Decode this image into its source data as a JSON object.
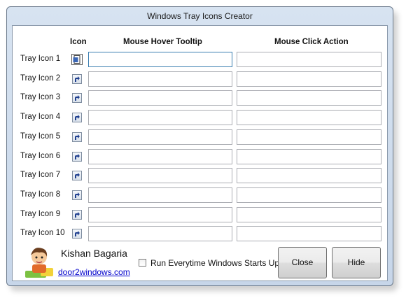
{
  "window": {
    "title": "Windows Tray Icons Creator"
  },
  "columns": {
    "icon": "Icon",
    "tooltip": "Mouse Hover Tooltip",
    "action": "Mouse Click Action"
  },
  "rows": [
    {
      "label": "Tray Icon 1",
      "tooltip": "",
      "action": ""
    },
    {
      "label": "Tray Icon 2",
      "tooltip": "",
      "action": ""
    },
    {
      "label": "Tray Icon 3",
      "tooltip": "",
      "action": ""
    },
    {
      "label": "Tray Icon 4",
      "tooltip": "",
      "action": ""
    },
    {
      "label": "Tray Icon 5",
      "tooltip": "",
      "action": ""
    },
    {
      "label": "Tray Icon 6",
      "tooltip": "",
      "action": ""
    },
    {
      "label": "Tray Icon 7",
      "tooltip": "",
      "action": ""
    },
    {
      "label": "Tray Icon 8",
      "tooltip": "",
      "action": ""
    },
    {
      "label": "Tray Icon 9",
      "tooltip": "",
      "action": ""
    },
    {
      "label": "Tray Icon 10",
      "tooltip": "",
      "action": ""
    }
  ],
  "footer": {
    "author": "Kishan Bagaria",
    "website": "door2windows.com",
    "startup_label": "Run Everytime Windows Starts Up",
    "startup_checked": false,
    "close_label": "Close",
    "hide_label": "Hide"
  },
  "icons": {
    "row1": "document-icon",
    "rows": "shortcut-arrow-icon",
    "avatar": "author-avatar-icon"
  },
  "colors": {
    "link": "#0000cc",
    "frame": "#c7d6e9"
  }
}
